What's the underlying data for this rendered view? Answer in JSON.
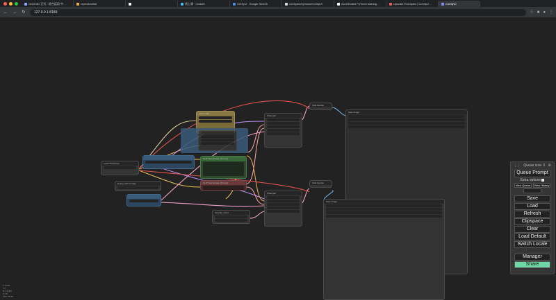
{
  "browser": {
    "tabs": [
      {
        "label": "cnexinter 正式 · 综合运用 中…",
        "active": false,
        "color": "#8aa8ff"
      },
      {
        "label": "OpenAesthet",
        "active": false,
        "color": "#f0b44a"
      },
      {
        "label": "",
        "active": false,
        "color": "#ffffff"
      },
      {
        "label": "线上课 · Lindoth",
        "active": false,
        "color": "#4fb8e8"
      },
      {
        "label": "comfyui · Google Search",
        "active": false,
        "color": "#4a8df0"
      },
      {
        "label": "comfyanonymous/ComfyUI",
        "active": false,
        "color": "#dddddd"
      },
      {
        "label": "Accelerated PyTorch training…",
        "active": false,
        "color": "#ffffff"
      },
      {
        "label": "Upscale Examples | ComfyU…",
        "active": false,
        "color": "#e35d5d"
      },
      {
        "label": "ComfyUI",
        "active": true,
        "color": "#8888ff"
      }
    ],
    "url": "127.0.0.1:8188"
  },
  "canvas": {
    "stats": [
      "T: 0.00s",
      "I: 0",
      "N: 14 [14]",
      "V: 28",
      "FPS: 55.56"
    ],
    "nodes": [
      {
        "title": "Load Checkpoint",
        "color": "#353535"
      },
      {
        "title": "CLIP Text Encode (Prompt)",
        "color": "#2d4a2d"
      },
      {
        "title": "CLIP Text Encode (Prompt)",
        "color": "#4a2a2a"
      },
      {
        "title": "Empty Latent Image",
        "color": "#353535"
      },
      {
        "title": "KSampler",
        "color": "#353535"
      },
      {
        "title": "KSampler",
        "color": "#353535"
      },
      {
        "title": "VAE Decode",
        "color": "#353535"
      },
      {
        "title": "VAE Decode",
        "color": "#353535"
      },
      {
        "title": "Save Image",
        "color": "#353535"
      },
      {
        "title": "Save Image",
        "color": "#353535"
      },
      {
        "title": "Upscale Latent",
        "color": "#353535"
      },
      {
        "title": "Load LoRA",
        "color": "#7a6a3a"
      }
    ]
  },
  "menu": {
    "title": "Queue size: 0",
    "queue_prompt": "Queue Prompt",
    "extra_options": "Extra options",
    "view_queue": "View Queue",
    "view_history": "View History",
    "save": "Save",
    "load": "Load",
    "refresh": "Refresh",
    "clipspace": "Clipspace",
    "clear": "Clear",
    "load_default": "Load Default",
    "switch_locale": "Switch Locale",
    "manager": "Manager",
    "share": "Share"
  }
}
